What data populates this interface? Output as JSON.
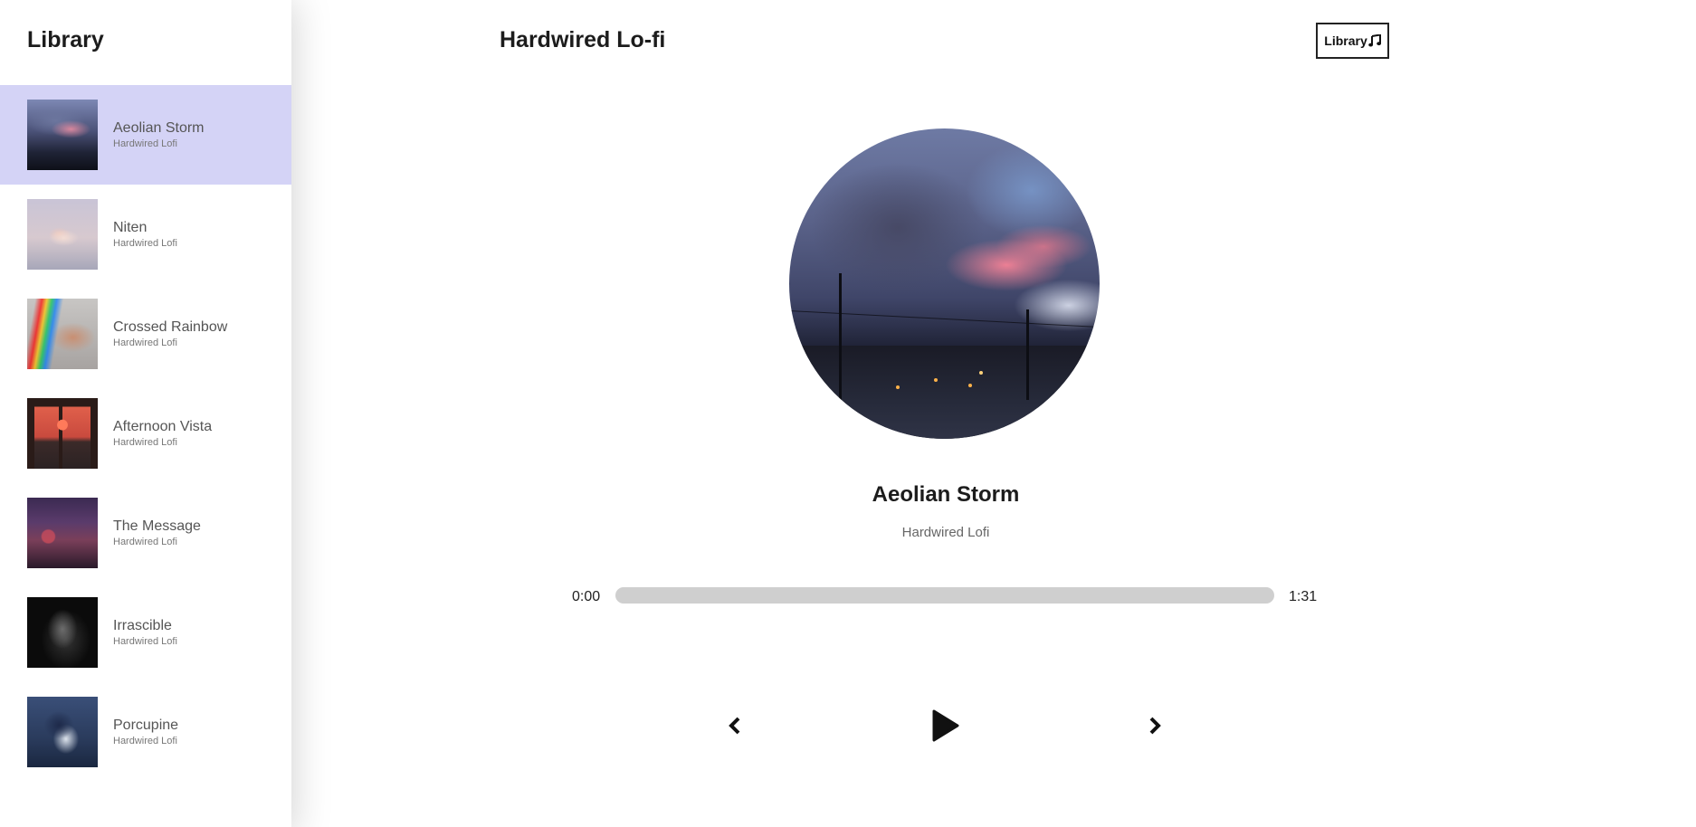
{
  "sidebar": {
    "title": "Library",
    "items": [
      {
        "name": "Aeolian Storm",
        "artist": "Hardwired Lofi",
        "active": true
      },
      {
        "name": "Niten",
        "artist": "Hardwired Lofi",
        "active": false
      },
      {
        "name": "Crossed Rainbow",
        "artist": "Hardwired Lofi",
        "active": false
      },
      {
        "name": "Afternoon Vista",
        "artist": "Hardwired Lofi",
        "active": false
      },
      {
        "name": "The Message",
        "artist": "Hardwired Lofi",
        "active": false
      },
      {
        "name": "Irrascible",
        "artist": "Hardwired Lofi",
        "active": false
      },
      {
        "name": "Porcupine",
        "artist": "Hardwired Lofi",
        "active": false
      }
    ]
  },
  "header": {
    "title": "Hardwired Lo-fi",
    "library_button_label": "Library",
    "library_button_icon": "music-note-icon"
  },
  "player": {
    "track_title": "Aeolian Storm",
    "track_artist": "Hardwired Lofi",
    "time_current": "0:00",
    "time_total": "1:31",
    "progress": 0,
    "controls": {
      "prev_icon": "chevron-left-icon",
      "play_icon": "play-icon",
      "next_icon": "chevron-right-icon"
    }
  },
  "colors": {
    "active_item_bg": "#d4d3f6",
    "progress_track": "#cfcfcf",
    "text_primary": "#1c1c1c",
    "text_secondary": "#666666"
  }
}
